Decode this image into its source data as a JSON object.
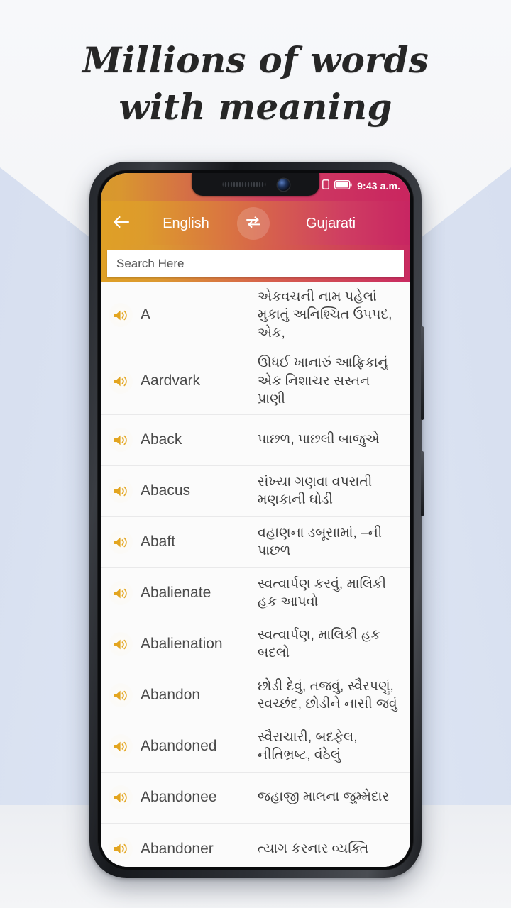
{
  "headline": {
    "line1": "Millions of words",
    "line2": "with meaning"
  },
  "status_bar": {
    "time": "9:43 a.m.",
    "wifi_icon": "wifi-icon",
    "sim_icon": "sim-card-icon",
    "battery_icon": "battery-full-icon"
  },
  "app_bar": {
    "back_icon": "back-arrow-icon",
    "source_language": "English",
    "swap_icon": "swap-horizontal-icon",
    "target_language": "Gujarati"
  },
  "search": {
    "placeholder": "Search Here",
    "value": ""
  },
  "colors": {
    "gradient_start": "#dfa026",
    "gradient_end": "#c82562",
    "speaker_icon": "#e3a51f",
    "background_panel": "#d6deef",
    "headline_text": "#262626"
  },
  "entries": [
    {
      "speaker_icon": "speaker-icon",
      "word": "A",
      "meaning": "એકવચની નામ પહેલાં મુકાતું અનિશ્ચિત ઉપપદ, એક,"
    },
    {
      "speaker_icon": "speaker-icon",
      "word": "Aardvark",
      "meaning": "ઊધઈ ખાનારું આફ્રિકાનું એક નિશાચર સસ્તન પ્રાણી"
    },
    {
      "speaker_icon": "speaker-icon",
      "word": "Aback",
      "meaning": "પાછળ, પાછલી બાજુએ"
    },
    {
      "speaker_icon": "speaker-icon",
      "word": "Abacus",
      "meaning": "સંખ્યા ગણવા વપરાતી મણકાની ઘોડી"
    },
    {
      "speaker_icon": "speaker-icon",
      "word": "Abaft",
      "meaning": "વહાણના ડબૂસામાં, –ની પાછળ"
    },
    {
      "speaker_icon": "speaker-icon",
      "word": "Abalienate",
      "meaning": "સ્વત્વાર્પણ કરવું, માલિકી હક આપવો"
    },
    {
      "speaker_icon": "speaker-icon",
      "word": "Abalienation",
      "meaning": "સ્વત્વાર્પણ, માલિકી હક બદલો"
    },
    {
      "speaker_icon": "speaker-icon",
      "word": "Abandon",
      "meaning": "છોડી દેવું, તજવું, સ્વૈરપણું, સ્વચ્છંદ, છોડીને નાસી જવું"
    },
    {
      "speaker_icon": "speaker-icon",
      "word": "Abandoned",
      "meaning": "સ્વૈરાચારી, બદફેલ, નીતિભ્રષ્ટ, વંઠેલું"
    },
    {
      "speaker_icon": "speaker-icon",
      "word": "Abandonee",
      "meaning": "જહાજી માલના જુમ્મેદાર"
    },
    {
      "speaker_icon": "speaker-icon",
      "word": "Abandoner",
      "meaning": "ત્યાગ કરનાર વ્યક્તિ"
    }
  ]
}
